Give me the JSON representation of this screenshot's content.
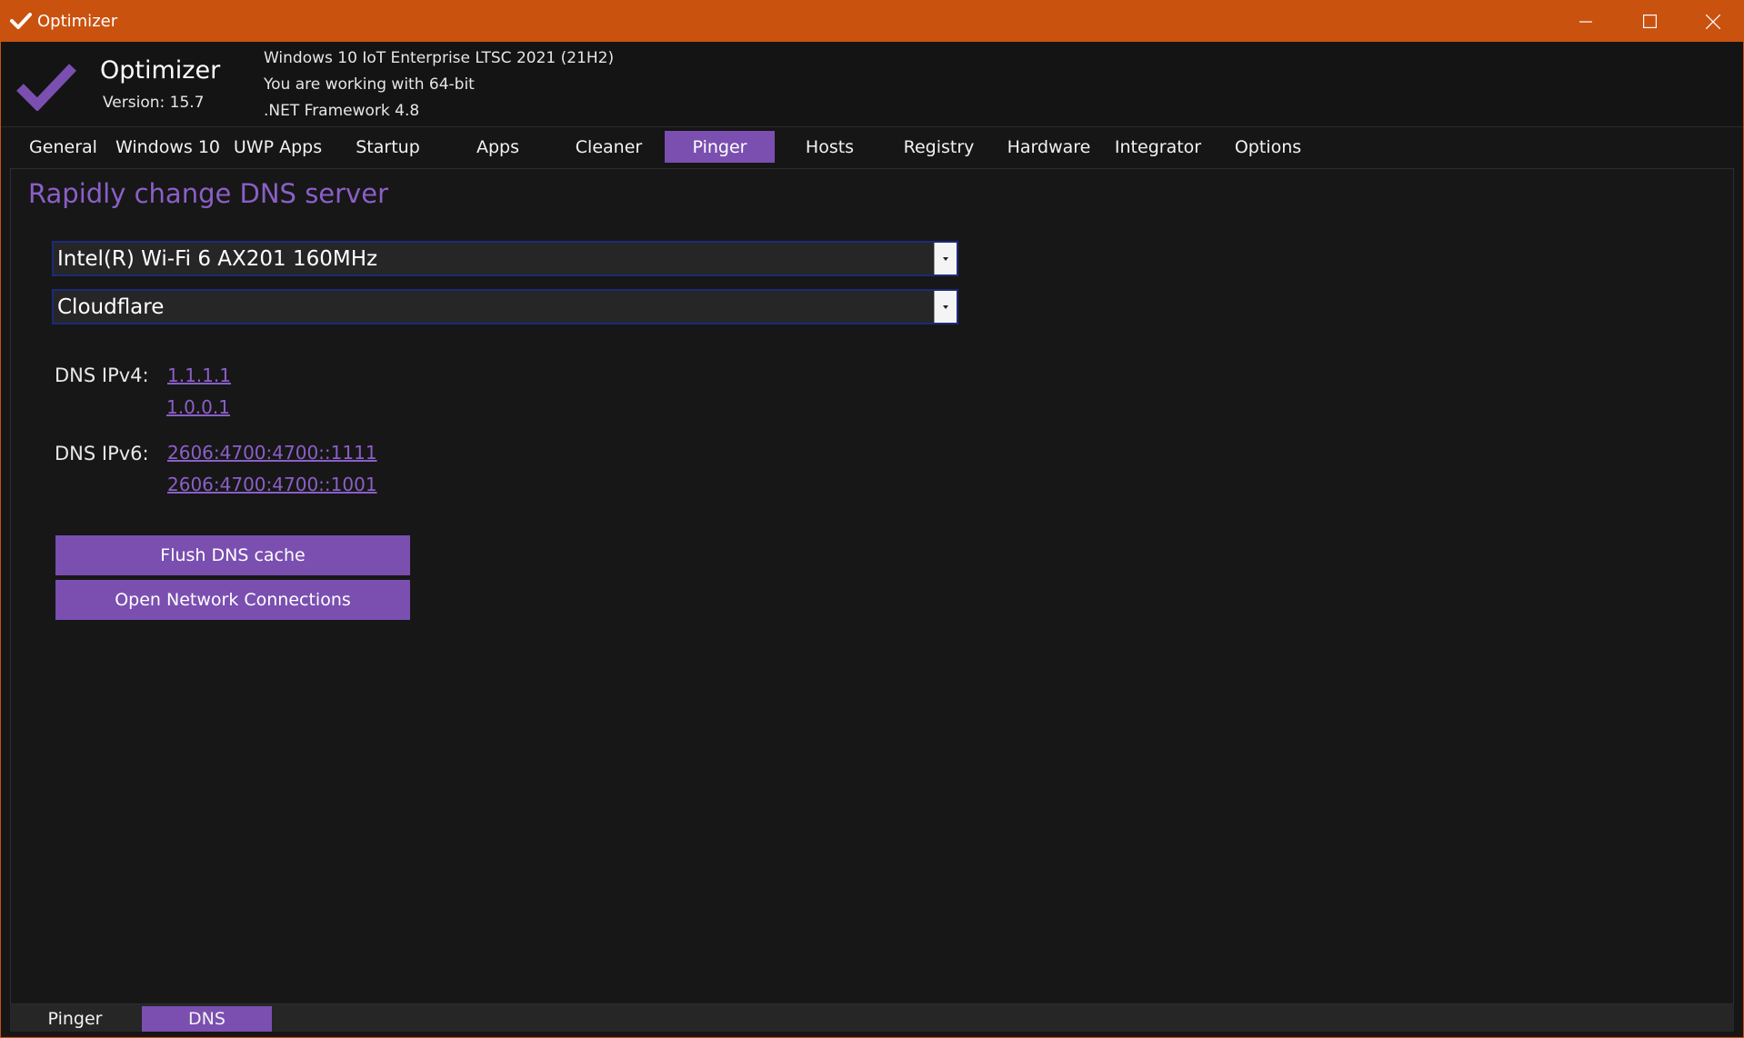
{
  "window": {
    "title": "Optimizer",
    "accent_color": "#c9520f"
  },
  "header": {
    "app_name": "Optimizer",
    "version": "Version: 15.7",
    "os_line": "Windows 10 IoT Enterprise LTSC 2021 (21H2)",
    "arch_line": "You are working with 64-bit",
    "framework_line": ".NET Framework 4.8",
    "brand_color": "#7a4fb0"
  },
  "tabs": [
    {
      "label": "General"
    },
    {
      "label": "Windows 10"
    },
    {
      "label": "UWP Apps"
    },
    {
      "label": "Startup"
    },
    {
      "label": "Apps"
    },
    {
      "label": "Cleaner"
    },
    {
      "label": "Pinger",
      "active": true
    },
    {
      "label": "Hosts"
    },
    {
      "label": "Registry"
    },
    {
      "label": "Hardware"
    },
    {
      "label": "Integrator"
    },
    {
      "label": "Options"
    }
  ],
  "dns": {
    "section_title": "Rapidly change DNS server",
    "adapter_selected": "Intel(R) Wi-Fi 6 AX201 160MHz",
    "provider_selected": "Cloudflare",
    "ipv4_label": "DNS IPv4:",
    "ipv4": [
      "1.1.1.1",
      "1.0.0.1"
    ],
    "ipv6_label": "DNS IPv6:",
    "ipv6": [
      "2606:4700:4700::1111",
      "2606:4700:4700::1001"
    ],
    "flush_button": "Flush DNS cache",
    "network_button": "Open Network Connections"
  },
  "subtabs": [
    {
      "label": "Pinger"
    },
    {
      "label": "DNS",
      "active": true
    }
  ],
  "icons": {
    "app": "checkmark-icon",
    "minimize": "minimize-icon",
    "maximize": "maximize-icon",
    "close": "close-icon",
    "dropdown": "chevron-down-icon"
  }
}
